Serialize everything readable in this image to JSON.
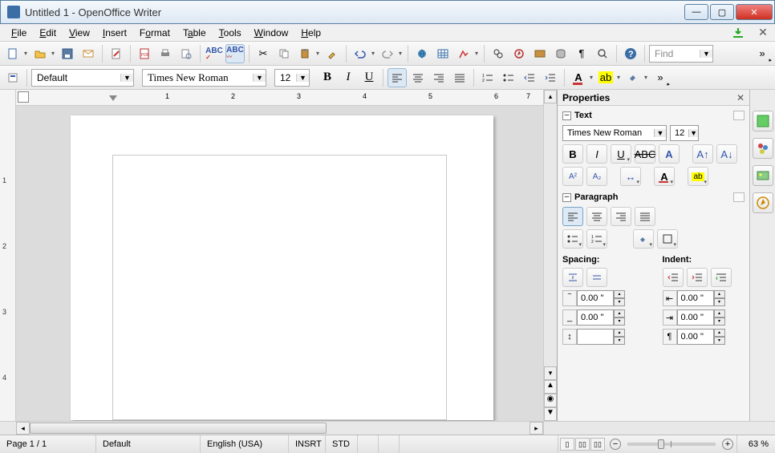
{
  "window": {
    "title": "Untitled 1 - OpenOffice Writer"
  },
  "menu": {
    "file": "File",
    "edit": "Edit",
    "view": "View",
    "insert": "Insert",
    "format": "Format",
    "table": "Table",
    "tools": "Tools",
    "window": "Window",
    "help": "Help"
  },
  "find": {
    "placeholder": "Find"
  },
  "format_bar": {
    "style": "Default",
    "font": "Times New Roman",
    "size": "12"
  },
  "properties": {
    "title": "Properties",
    "text_section": "Text",
    "paragraph_section": "Paragraph",
    "font": "Times New Roman",
    "size": "12",
    "spacing_label": "Spacing:",
    "indent_label": "Indent:",
    "spin_above": "0.00 \"",
    "spin_below": "0.00 \"",
    "spin_line": "",
    "indent_left": "0.00 \"",
    "indent_right": "0.00 \"",
    "indent_first": "0.00 \""
  },
  "status": {
    "page": "Page 1 / 1",
    "style": "Default",
    "lang": "English (USA)",
    "insert": "INSRT",
    "sel": "STD",
    "zoom": "63 %"
  },
  "ruler": {
    "h": [
      "1",
      "2",
      "3",
      "4",
      "5",
      "6",
      "7"
    ],
    "v": [
      "1",
      "2",
      "3",
      "4"
    ]
  }
}
